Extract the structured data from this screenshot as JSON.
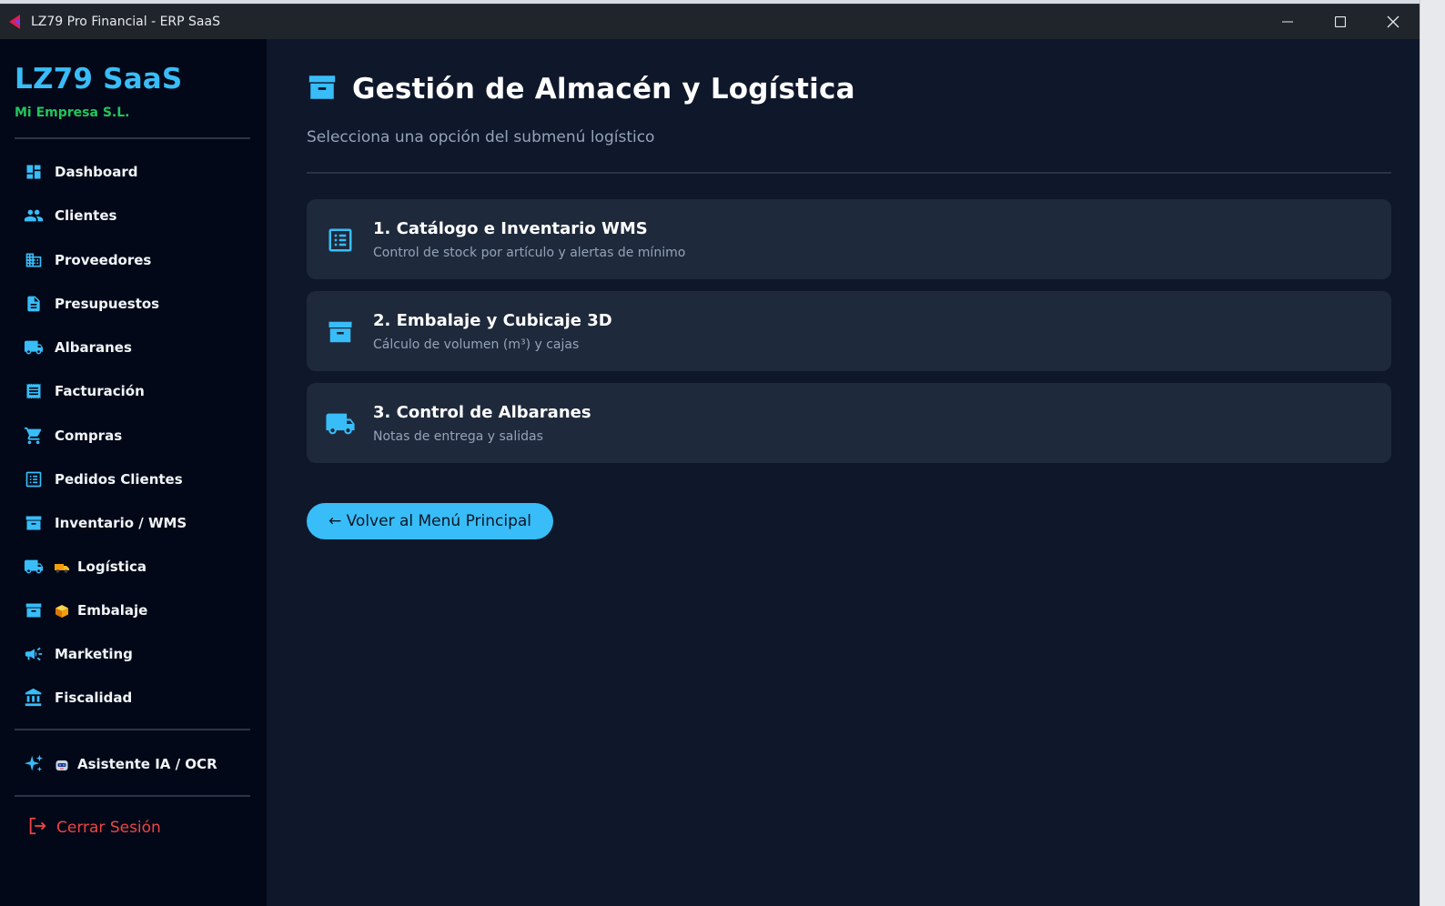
{
  "window": {
    "title": "LZ79 Pro Financial - ERP SaaS",
    "icons": [
      "app-logo-icon",
      "minimize-icon",
      "maximize-icon",
      "close-icon"
    ]
  },
  "sidebar": {
    "brand": "LZ79 SaaS",
    "company": "Mi Empresa S.L.",
    "items": [
      {
        "label": "Dashboard",
        "icon": "dashboard-icon"
      },
      {
        "label": "Clientes",
        "icon": "people-icon"
      },
      {
        "label": "Proveedores",
        "icon": "building-icon"
      },
      {
        "label": "Presupuestos",
        "icon": "document-icon"
      },
      {
        "label": "Albaranes",
        "icon": "truck-icon"
      },
      {
        "label": "Facturación",
        "icon": "receipt-icon"
      },
      {
        "label": "Compras",
        "icon": "cart-icon"
      },
      {
        "label": "Pedidos Clientes",
        "icon": "list-icon"
      },
      {
        "label": "Inventario / WMS",
        "icon": "archive-icon"
      },
      {
        "label": "Logística",
        "icon": "truck-icon",
        "emoji": "delivery-truck-emoji"
      },
      {
        "label": "Embalaje",
        "icon": "archive-icon",
        "emoji": "package-emoji"
      },
      {
        "label": "Marketing",
        "icon": "megaphone-icon"
      },
      {
        "label": "Fiscalidad",
        "icon": "bank-icon"
      }
    ],
    "assistant": {
      "label": "Asistente IA / OCR",
      "icon": "sparkle-icon",
      "emoji": "robot-emoji"
    },
    "logout": {
      "label": "Cerrar Sesión",
      "icon": "logout-icon"
    }
  },
  "main": {
    "title": "Gestión de Almacén y Logística",
    "title_icon": "archive-icon",
    "subtitle": "Selecciona una opción del submenú logístico",
    "cards": [
      {
        "title": "1. Catálogo e Inventario WMS",
        "description": "Control de stock por artículo y alertas de mínimo",
        "icon": "list-icon"
      },
      {
        "title": "2. Embalaje y Cubicaje 3D",
        "description": "Cálculo de volumen (m³) y cajas",
        "icon": "archive-icon"
      },
      {
        "title": "3. Control de Albaranes",
        "description": "Notas de entrega y salidas",
        "icon": "truck-icon"
      }
    ],
    "back_button": "← Volver al Menú Principal"
  },
  "colors": {
    "accent": "#38bdf8",
    "company": "#22c55e",
    "danger": "#ef4444",
    "sidebar_bg": "#020817",
    "main_bg": "#0f172a",
    "card_bg": "#1e293b"
  }
}
